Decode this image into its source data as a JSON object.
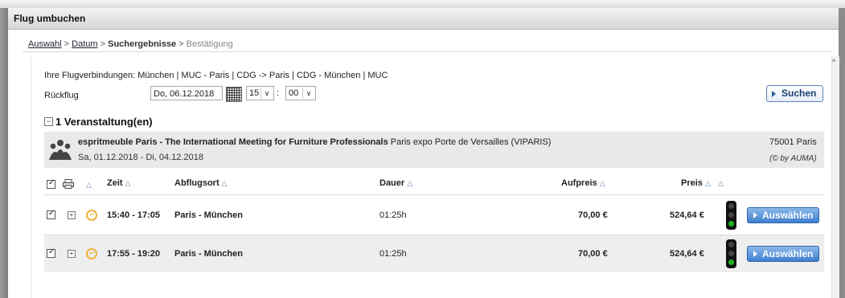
{
  "window": {
    "title": "Flug umbuchen"
  },
  "breadcrumb": {
    "step1": "Auswahl",
    "step2": "Datum",
    "step3": "Suchergebnisse",
    "step4": "Bestätigung",
    "separator": ">"
  },
  "search": {
    "connections": "Ihre Flugverbindungen: München | MUC - Paris | CDG -> Paris | CDG - München | MUC",
    "return_label": "Rückflug",
    "date_value": "Do, 06.12.2018",
    "hour_value": "15",
    "minute_value": "00",
    "time_separator": ":",
    "search_button": "Suchen"
  },
  "events": {
    "heading": "1 Veranstaltung(en)",
    "collapse_symbol": "−",
    "item": {
      "name": "espritmeuble Paris - The International Meeting for Furniture Professionals",
      "venue": "Paris expo Porte de Versailles (VIPARIS)",
      "dates": "Sa, 01.12.2018 - Di, 04.12.2018",
      "city": "75001 Paris",
      "source": "(© by AUMA)"
    }
  },
  "table": {
    "headers": {
      "time": "Zeit",
      "departure": "Abflugsort",
      "duration": "Dauer",
      "surcharge": "Aufpreis",
      "price": "Preis"
    },
    "select_button": "Auswählen",
    "rows": [
      {
        "time": "15:40 - 17:05",
        "route": "Paris - München",
        "duration": "01:25h",
        "surcharge": "70,00 €",
        "price": "524,64 €",
        "status": "green"
      },
      {
        "time": "17:55 - 19:20",
        "route": "Paris - München",
        "duration": "01:25h",
        "surcharge": "70,00 €",
        "price": "524,64 €",
        "status": "green"
      }
    ]
  },
  "colors": {
    "accent_button": "#3f7fcf",
    "clock_icon": "#f0b23a",
    "traffic_green": "#1db51d"
  }
}
